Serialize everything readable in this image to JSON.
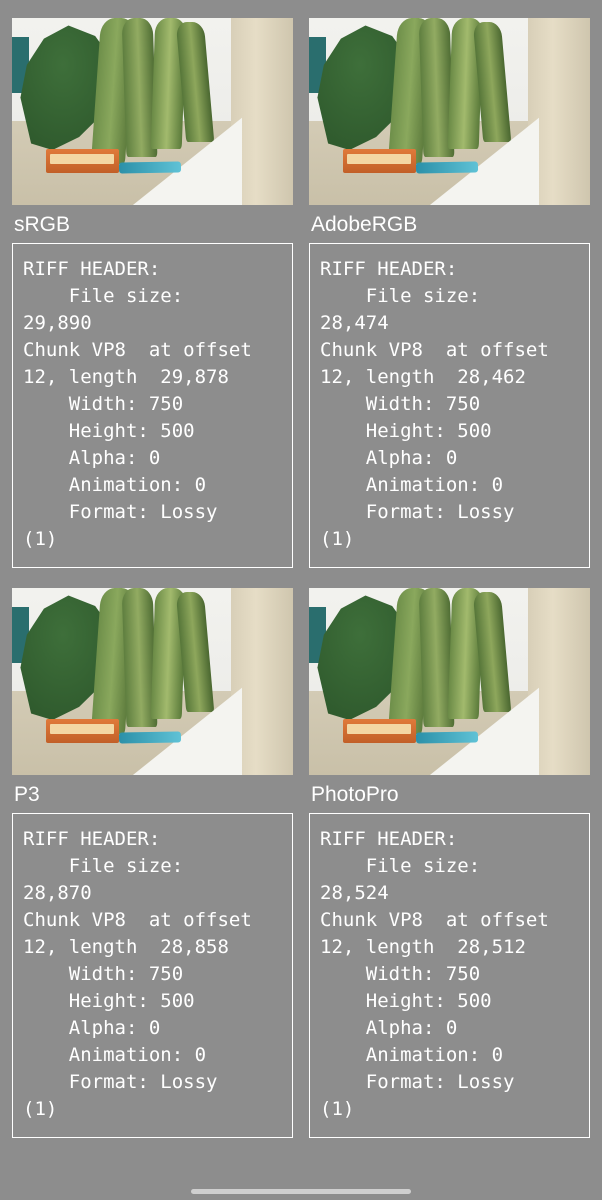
{
  "panels": [
    {
      "title": "sRGB",
      "riff": {
        "header_label": "RIFF HEADER:",
        "file_size_label": "File size:",
        "file_size": "29,890",
        "chunk_line": "Chunk VP8  at offset 12, length  29,878",
        "width_label": "Width:",
        "width": "750",
        "height_label": "Height:",
        "height": "500",
        "alpha_label": "Alpha:",
        "alpha": "0",
        "animation_label": "Animation:",
        "animation": "0",
        "format_label": "Format:",
        "format": "Lossy (1)"
      }
    },
    {
      "title": "AdobeRGB",
      "riff": {
        "header_label": "RIFF HEADER:",
        "file_size_label": "File size:",
        "file_size": "28,474",
        "chunk_line": "Chunk VP8  at offset 12, length  28,462",
        "width_label": "Width:",
        "width": "750",
        "height_label": "Height:",
        "height": "500",
        "alpha_label": "Alpha:",
        "alpha": "0",
        "animation_label": "Animation:",
        "animation": "0",
        "format_label": "Format:",
        "format": "Lossy (1)"
      }
    },
    {
      "title": "P3",
      "riff": {
        "header_label": "RIFF HEADER:",
        "file_size_label": "File size:",
        "file_size": "28,870",
        "chunk_line": "Chunk VP8  at offset 12, length  28,858",
        "width_label": "Width:",
        "width": "750",
        "height_label": "Height:",
        "height": "500",
        "alpha_label": "Alpha:",
        "alpha": "0",
        "animation_label": "Animation:",
        "animation": "0",
        "format_label": "Format:",
        "format": "Lossy (1)"
      }
    },
    {
      "title": "PhotoPro",
      "riff": {
        "header_label": "RIFF HEADER:",
        "file_size_label": "File size:",
        "file_size": "28,524",
        "chunk_line": "Chunk VP8  at offset 12, length  28,512",
        "width_label": "Width:",
        "width": "750",
        "height_label": "Height:",
        "height": "500",
        "alpha_label": "Alpha:",
        "alpha": "0",
        "animation_label": "Animation:",
        "animation": "0",
        "format_label": "Format:",
        "format": "Lossy (1)"
      }
    }
  ]
}
